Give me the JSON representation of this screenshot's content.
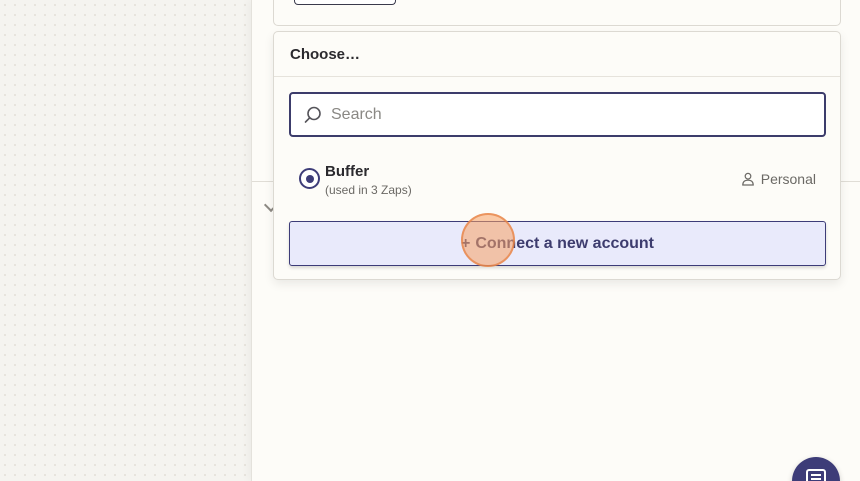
{
  "dropdown": {
    "title": "Choose…",
    "search_placeholder": "Search",
    "accounts": [
      {
        "name": "Buffer",
        "usage": "(used in 3 Zaps)",
        "type": "Personal",
        "selected": true
      }
    ],
    "connect_label": "Connect a new account",
    "connect_prefix": "+"
  },
  "icons": {
    "search": "search-icon",
    "person": "person-icon",
    "chat": "chat-icon"
  },
  "colors": {
    "accent": "#3d3c78",
    "connect_bg": "#e9eafb",
    "click_marker": "#f7a064"
  }
}
